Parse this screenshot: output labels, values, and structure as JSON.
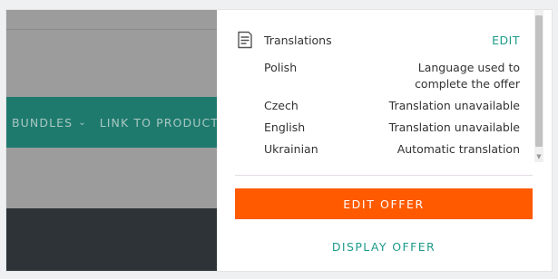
{
  "background": {
    "nav_items": [
      {
        "label": "BUNDLES",
        "has_chevron": true
      },
      {
        "label": "LINK TO PRODUCT",
        "has_chevron": false
      }
    ]
  },
  "translations": {
    "title": "Translations",
    "edit_label": "EDIT",
    "icon": "document-icon",
    "languages": [
      {
        "name": "Polish",
        "status": "Language used to complete the offer"
      },
      {
        "name": "Czech",
        "status": "Translation unavailable"
      },
      {
        "name": "English",
        "status": "Translation unavailable"
      },
      {
        "name": "Ukrainian",
        "status": "Automatic translation"
      }
    ]
  },
  "actions": {
    "edit_offer_label": "EDIT OFFER",
    "display_offer_label": "DISPLAY OFFER"
  },
  "colors": {
    "accent_teal": "#1d9a8a",
    "primary_orange": "#ff5a00",
    "nav_teal": "#1f7a6e",
    "dark_footer": "#2e3337"
  }
}
